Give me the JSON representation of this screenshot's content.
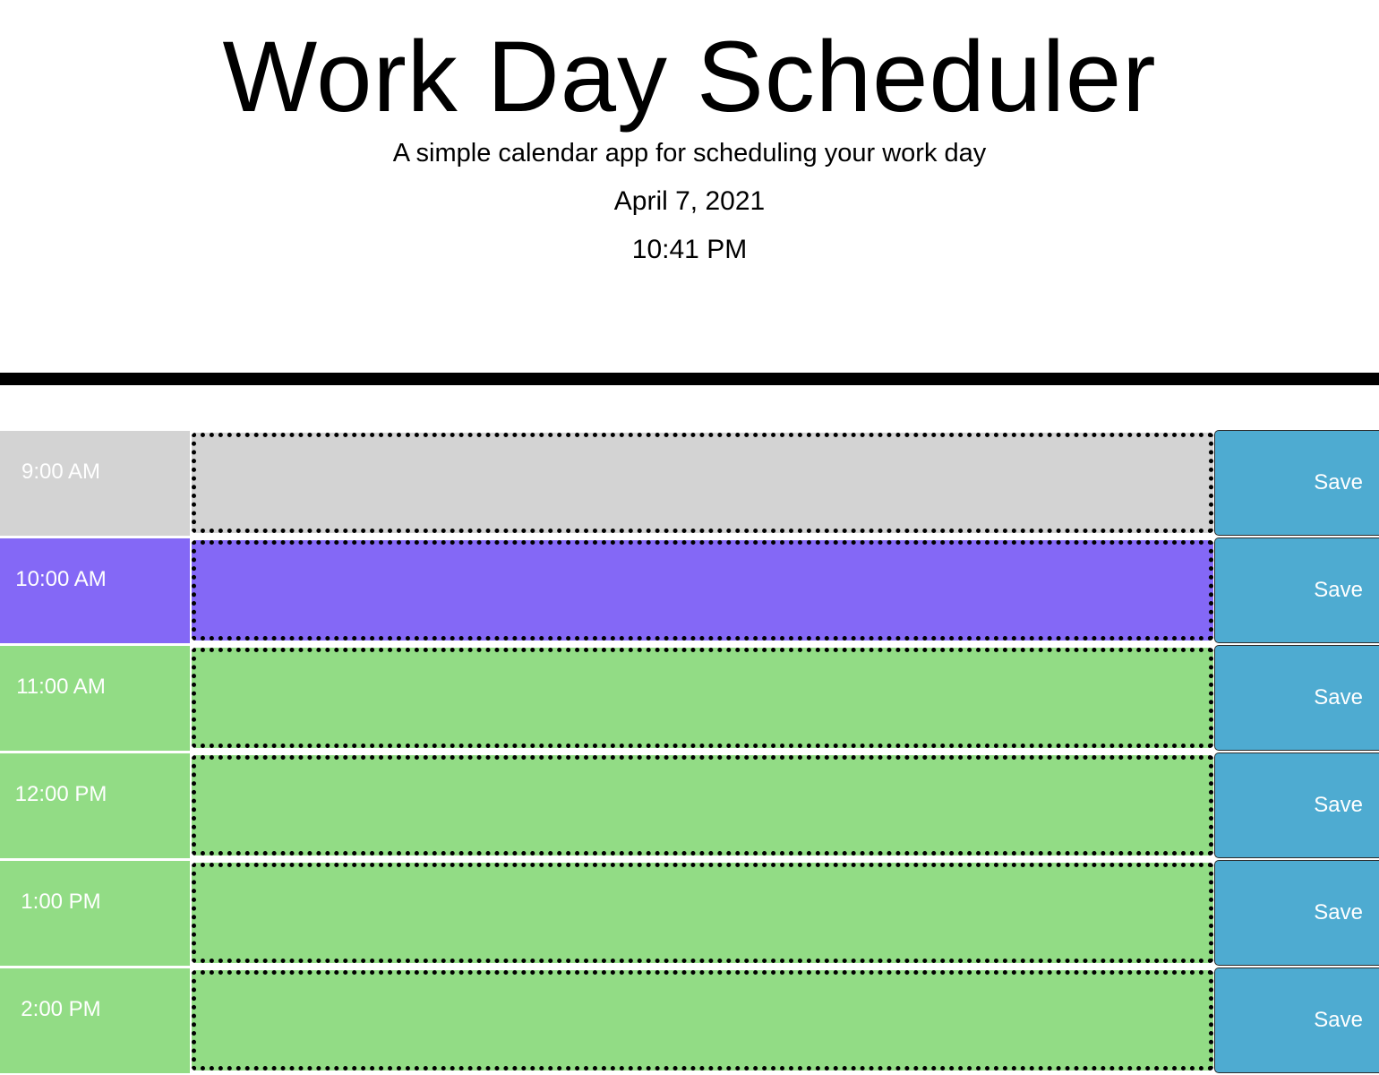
{
  "header": {
    "title": "Work Day Scheduler",
    "subtitle": "A simple calendar app for scheduling your work day",
    "date": "April 7, 2021",
    "time": "10:41 PM"
  },
  "colors": {
    "past": "#d3d3d3",
    "present": "#8468f6",
    "future": "#92dc85",
    "save_button": "#4eabd1"
  },
  "rows": [
    {
      "hour": "9:00 AM",
      "state": "past",
      "description": "",
      "save_label": "Save"
    },
    {
      "hour": "10:00 AM",
      "state": "present",
      "description": "",
      "save_label": "Save"
    },
    {
      "hour": "11:00 AM",
      "state": "future",
      "description": "",
      "save_label": "Save"
    },
    {
      "hour": "12:00 PM",
      "state": "future",
      "description": "",
      "save_label": "Save"
    },
    {
      "hour": "1:00 PM",
      "state": "future",
      "description": "",
      "save_label": "Save"
    },
    {
      "hour": "2:00 PM",
      "state": "future",
      "description": "",
      "save_label": "Save"
    }
  ]
}
